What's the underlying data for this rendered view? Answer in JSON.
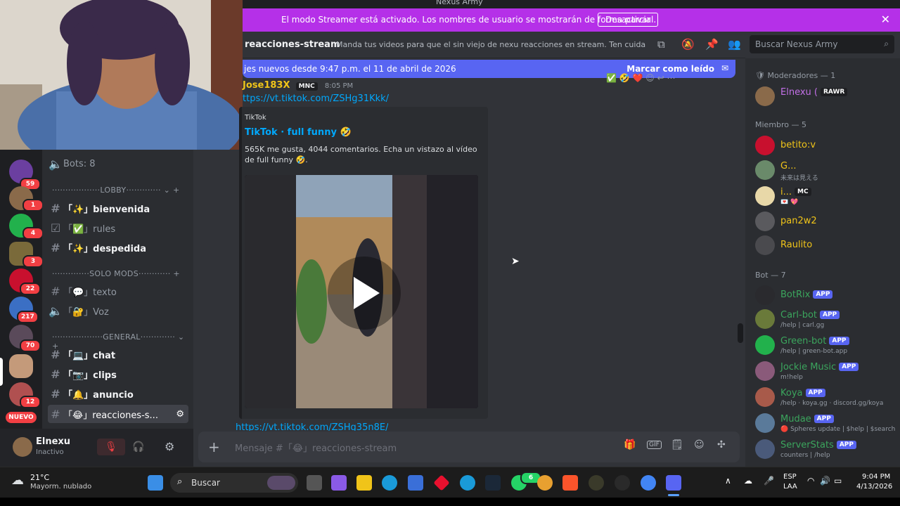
{
  "window": {
    "title": "Nexus Army"
  },
  "servers": [
    {
      "badge": "59"
    },
    {
      "badge": "1"
    },
    {
      "badge": "4"
    },
    {
      "badge": "3"
    },
    {
      "badge": "22"
    },
    {
      "badge": "217"
    },
    {
      "badge": "70"
    },
    {
      "badge": ""
    },
    {
      "badge": "12"
    }
  ],
  "nuevo_label": "NUEVO",
  "channels": {
    "bots_label": "Bots: 8",
    "cat_lobby": "··················LOBBY·············",
    "cat_solomods": "··············SOLO MODS············",
    "cat_general": "···················GENERAL·············",
    "items": [
      {
        "label": "「✨」bienvenida"
      },
      {
        "label": "「✅」rules"
      },
      {
        "label": "「✨」despedida"
      },
      {
        "label": "「💬」texto"
      },
      {
        "label": "「🔐」Voz"
      },
      {
        "label": "「💻」chat"
      },
      {
        "label": "「📷」clips"
      },
      {
        "label": "「🔔」anuncio"
      },
      {
        "label": "「😂」reacciones-s..."
      }
    ]
  },
  "user": {
    "name": "Elnexu",
    "status": "Inactivo"
  },
  "banner": {
    "text": "El modo Streamer está activado. Los nombres de usuario se mostrarán de forma parcial.",
    "button": "Desactivar"
  },
  "header": {
    "channel": "reacciones-stream",
    "topic": "Manda tus videos para que el sin viejo de nexu reacciones en stream. Ten cuidado con l...",
    "search_placeholder": "Buscar Nexus Army"
  },
  "newbar": {
    "text": "jes nuevos desde 9:47 p.m. el 11 de abril de 2026",
    "action": "Marcar como leído"
  },
  "message": {
    "author": "Jose183X",
    "tag": "MNC",
    "time": "8:05 PM",
    "link": "ttps://vt.tiktok.com/ZSHg31Kkk/",
    "embed_provider": "TikTok",
    "embed_title": "TikTok · full funny 🤣",
    "embed_desc": "565K me gusta, 4044 comentarios. Echa un vistazo al vídeo de full funny 🤣.",
    "next_link": "https://vt.tiktok.com/ZSHg35n8E/"
  },
  "composer": {
    "placeholder": "Mensaje #「😂」reacciones-stream"
  },
  "members": {
    "mods_header": "Moderadores — 1",
    "members_header": "Miembro — 5",
    "bots_header": "Bot — 7",
    "mods": [
      {
        "name": "Elnexu (",
        "tag": "RAWR",
        "color": "#c370e8"
      }
    ],
    "members": [
      {
        "name": "betito:v",
        "sub": "",
        "color": "#f0c419"
      },
      {
        "name": "G...",
        "sub": "未来は見える",
        "color": "#f0c419"
      },
      {
        "name": "i...",
        "tag": "MC",
        "sub": "💌 💖",
        "color": "#f0c419"
      },
      {
        "name": "pan2w2",
        "sub": "",
        "color": "#f0c419"
      },
      {
        "name": "Raulito",
        "sub": "",
        "color": "#f0c419"
      }
    ],
    "bots": [
      {
        "name": "BotRix",
        "app": "APP",
        "sub": "",
        "color": "#3ba55d"
      },
      {
        "name": "Carl-bot",
        "app": "APP",
        "sub": "/help | carl.gg",
        "color": "#3ba55d"
      },
      {
        "name": "Green-bot",
        "app": "APP",
        "sub": "/help | green-bot.app",
        "color": "#3ba55d"
      },
      {
        "name": "Jockie Music",
        "app": "APP",
        "sub": "m!help",
        "color": "#3ba55d"
      },
      {
        "name": "Koya",
        "app": "APP",
        "sub": "/help · koya.gg · discord.gg/koya",
        "color": "#3ba55d"
      },
      {
        "name": "Mudae",
        "app": "APP",
        "sub": "🔴 Spheres update | $help | $search",
        "color": "#3ba55d"
      },
      {
        "name": "ServerStats",
        "app": "APP",
        "sub": "counters | /help",
        "color": "#3ba55d"
      }
    ]
  },
  "taskbar": {
    "weather_temp": "21°C",
    "weather_desc": "Mayorm. nublado",
    "search": "Buscar",
    "lang1": "ESP",
    "lang2": "LAA",
    "time": "9:04 PM",
    "date": "4/13/2026",
    "chat_badge": "6"
  }
}
